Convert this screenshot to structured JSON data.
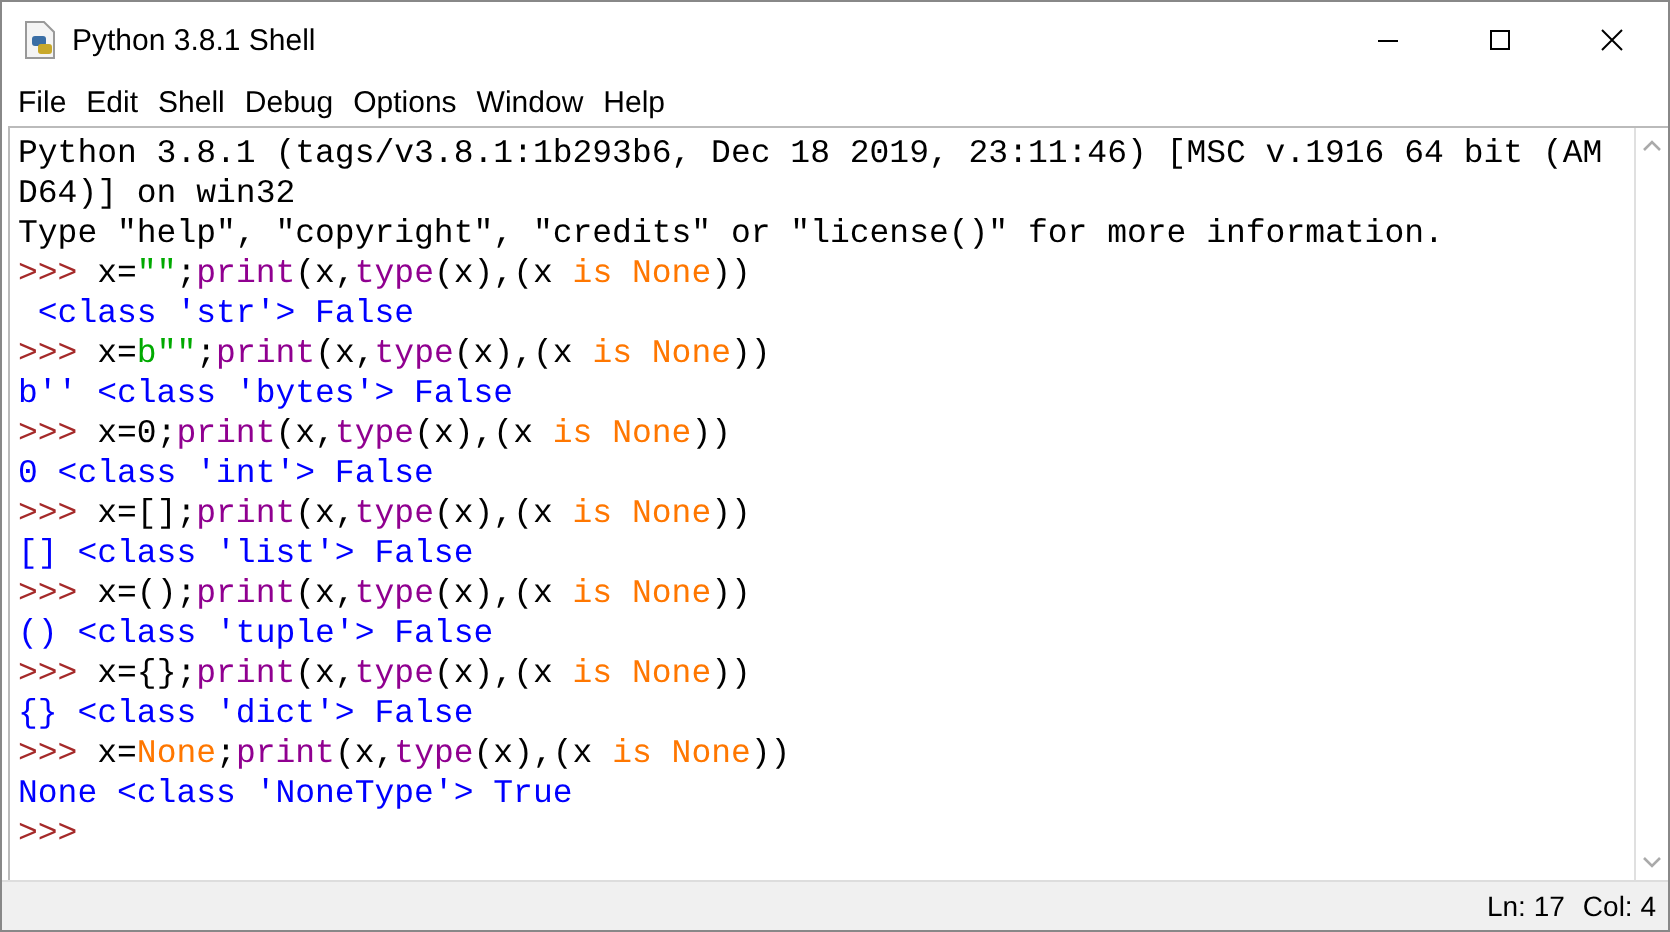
{
  "window": {
    "title": "Python 3.8.1 Shell"
  },
  "menu": [
    "File",
    "Edit",
    "Shell",
    "Debug",
    "Options",
    "Window",
    "Help"
  ],
  "shell_lines": [
    {
      "tokens": [
        {
          "kind": "plain",
          "text": "Python 3.8.1 (tags/v3.8.1:1b293b6, Dec 18 2019, 23:11:46) [MSC v.1916 64 bit (AM"
        }
      ]
    },
    {
      "tokens": [
        {
          "kind": "plain",
          "text": "D64)] on win32"
        }
      ]
    },
    {
      "tokens": [
        {
          "kind": "plain",
          "text": "Type \"help\", \"copyright\", \"credits\" or \"license()\" for more information."
        }
      ]
    },
    {
      "tokens": [
        {
          "kind": "prompt",
          "text": ">>> "
        },
        {
          "kind": "plain",
          "text": "x="
        },
        {
          "kind": "string",
          "text": "\"\""
        },
        {
          "kind": "plain",
          "text": ";"
        },
        {
          "kind": "builtin",
          "text": "print"
        },
        {
          "kind": "plain",
          "text": "(x,"
        },
        {
          "kind": "builtin",
          "text": "type"
        },
        {
          "kind": "plain",
          "text": "(x),(x "
        },
        {
          "kind": "keyword",
          "text": "is None"
        },
        {
          "kind": "plain",
          "text": "))"
        }
      ]
    },
    {
      "tokens": [
        {
          "kind": "output",
          "text": " <class 'str'> False"
        }
      ]
    },
    {
      "tokens": [
        {
          "kind": "prompt",
          "text": ">>> "
        },
        {
          "kind": "plain",
          "text": "x="
        },
        {
          "kind": "string",
          "text": "b\"\""
        },
        {
          "kind": "plain",
          "text": ";"
        },
        {
          "kind": "builtin",
          "text": "print"
        },
        {
          "kind": "plain",
          "text": "(x,"
        },
        {
          "kind": "builtin",
          "text": "type"
        },
        {
          "kind": "plain",
          "text": "(x),(x "
        },
        {
          "kind": "keyword",
          "text": "is None"
        },
        {
          "kind": "plain",
          "text": "))"
        }
      ]
    },
    {
      "tokens": [
        {
          "kind": "output",
          "text": "b'' <class 'bytes'> False"
        }
      ]
    },
    {
      "tokens": [
        {
          "kind": "prompt",
          "text": ">>> "
        },
        {
          "kind": "plain",
          "text": "x=0;"
        },
        {
          "kind": "builtin",
          "text": "print"
        },
        {
          "kind": "plain",
          "text": "(x,"
        },
        {
          "kind": "builtin",
          "text": "type"
        },
        {
          "kind": "plain",
          "text": "(x),(x "
        },
        {
          "kind": "keyword",
          "text": "is None"
        },
        {
          "kind": "plain",
          "text": "))"
        }
      ]
    },
    {
      "tokens": [
        {
          "kind": "output",
          "text": "0 <class 'int'> False"
        }
      ]
    },
    {
      "tokens": [
        {
          "kind": "prompt",
          "text": ">>> "
        },
        {
          "kind": "plain",
          "text": "x=[];"
        },
        {
          "kind": "builtin",
          "text": "print"
        },
        {
          "kind": "plain",
          "text": "(x,"
        },
        {
          "kind": "builtin",
          "text": "type"
        },
        {
          "kind": "plain",
          "text": "(x),(x "
        },
        {
          "kind": "keyword",
          "text": "is None"
        },
        {
          "kind": "plain",
          "text": "))"
        }
      ]
    },
    {
      "tokens": [
        {
          "kind": "output",
          "text": "[] <class 'list'> False"
        }
      ]
    },
    {
      "tokens": [
        {
          "kind": "prompt",
          "text": ">>> "
        },
        {
          "kind": "plain",
          "text": "x=();"
        },
        {
          "kind": "builtin",
          "text": "print"
        },
        {
          "kind": "plain",
          "text": "(x,"
        },
        {
          "kind": "builtin",
          "text": "type"
        },
        {
          "kind": "plain",
          "text": "(x),(x "
        },
        {
          "kind": "keyword",
          "text": "is None"
        },
        {
          "kind": "plain",
          "text": "))"
        }
      ]
    },
    {
      "tokens": [
        {
          "kind": "output",
          "text": "() <class 'tuple'> False"
        }
      ]
    },
    {
      "tokens": [
        {
          "kind": "prompt",
          "text": ">>> "
        },
        {
          "kind": "plain",
          "text": "x={};"
        },
        {
          "kind": "builtin",
          "text": "print"
        },
        {
          "kind": "plain",
          "text": "(x,"
        },
        {
          "kind": "builtin",
          "text": "type"
        },
        {
          "kind": "plain",
          "text": "(x),(x "
        },
        {
          "kind": "keyword",
          "text": "is None"
        },
        {
          "kind": "plain",
          "text": "))"
        }
      ]
    },
    {
      "tokens": [
        {
          "kind": "output",
          "text": "{} <class 'dict'> False"
        }
      ]
    },
    {
      "tokens": [
        {
          "kind": "prompt",
          "text": ">>> "
        },
        {
          "kind": "plain",
          "text": "x="
        },
        {
          "kind": "keyword",
          "text": "None"
        },
        {
          "kind": "plain",
          "text": ";"
        },
        {
          "kind": "builtin",
          "text": "print"
        },
        {
          "kind": "plain",
          "text": "(x,"
        },
        {
          "kind": "builtin",
          "text": "type"
        },
        {
          "kind": "plain",
          "text": "(x),(x "
        },
        {
          "kind": "keyword",
          "text": "is None"
        },
        {
          "kind": "plain",
          "text": "))"
        }
      ]
    },
    {
      "tokens": [
        {
          "kind": "output",
          "text": "None <class 'NoneType'> True"
        }
      ]
    },
    {
      "tokens": [
        {
          "kind": "prompt",
          "text": ">>>"
        }
      ]
    }
  ],
  "status_bar": {
    "line": "Ln: 17",
    "column": "Col: 4"
  }
}
